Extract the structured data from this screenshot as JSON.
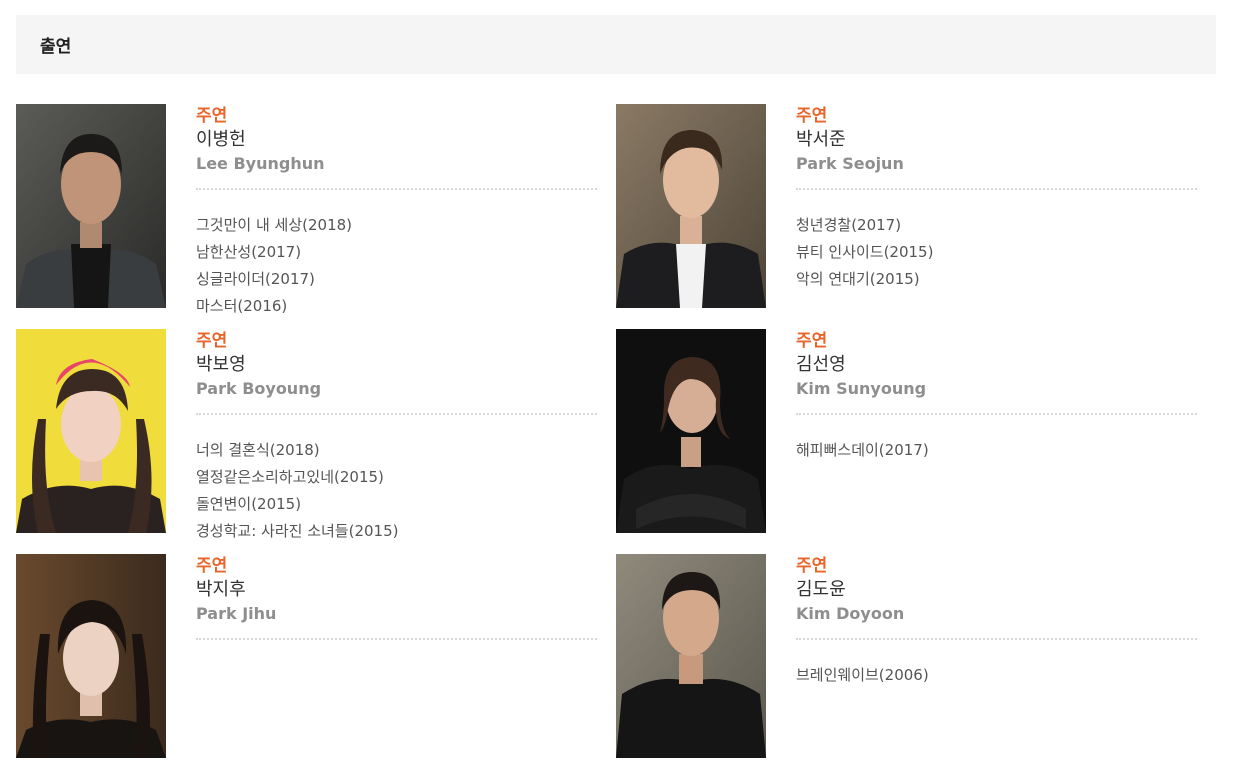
{
  "section": {
    "title": "출연"
  },
  "cast": [
    {
      "role": "주연",
      "name_ko": "이병헌",
      "name_en": "Lee Byunghun",
      "works": [
        "그것만이 내 세상(2018)",
        "남한산성(2017)",
        "싱글라이더(2017)",
        "마스터(2016)"
      ]
    },
    {
      "role": "주연",
      "name_ko": "박서준",
      "name_en": "Park Seojun",
      "works": [
        "청년경찰(2017)",
        "뷰티 인사이드(2015)",
        "악의 연대기(2015)"
      ]
    },
    {
      "role": "주연",
      "name_ko": "박보영",
      "name_en": "Park Boyoung",
      "works": [
        "너의 결혼식(2018)",
        "열정같은소리하고있네(2015)",
        "돌연변이(2015)",
        "경성학교: 사라진 소녀들(2015)"
      ]
    },
    {
      "role": "주연",
      "name_ko": "김선영",
      "name_en": "Kim Sunyoung",
      "works": [
        "해피뻐스데이(2017)"
      ]
    },
    {
      "role": "주연",
      "name_ko": "박지후",
      "name_en": "Park Jihu",
      "works": []
    },
    {
      "role": "주연",
      "name_ko": "김도윤",
      "name_en": "Kim Doyoon",
      "works": [
        "브레인웨이브(2006)"
      ]
    }
  ],
  "colors": {
    "role": "#e8652b",
    "header_bg": "#f5f5f5",
    "english_name": "#8e8e8e"
  }
}
